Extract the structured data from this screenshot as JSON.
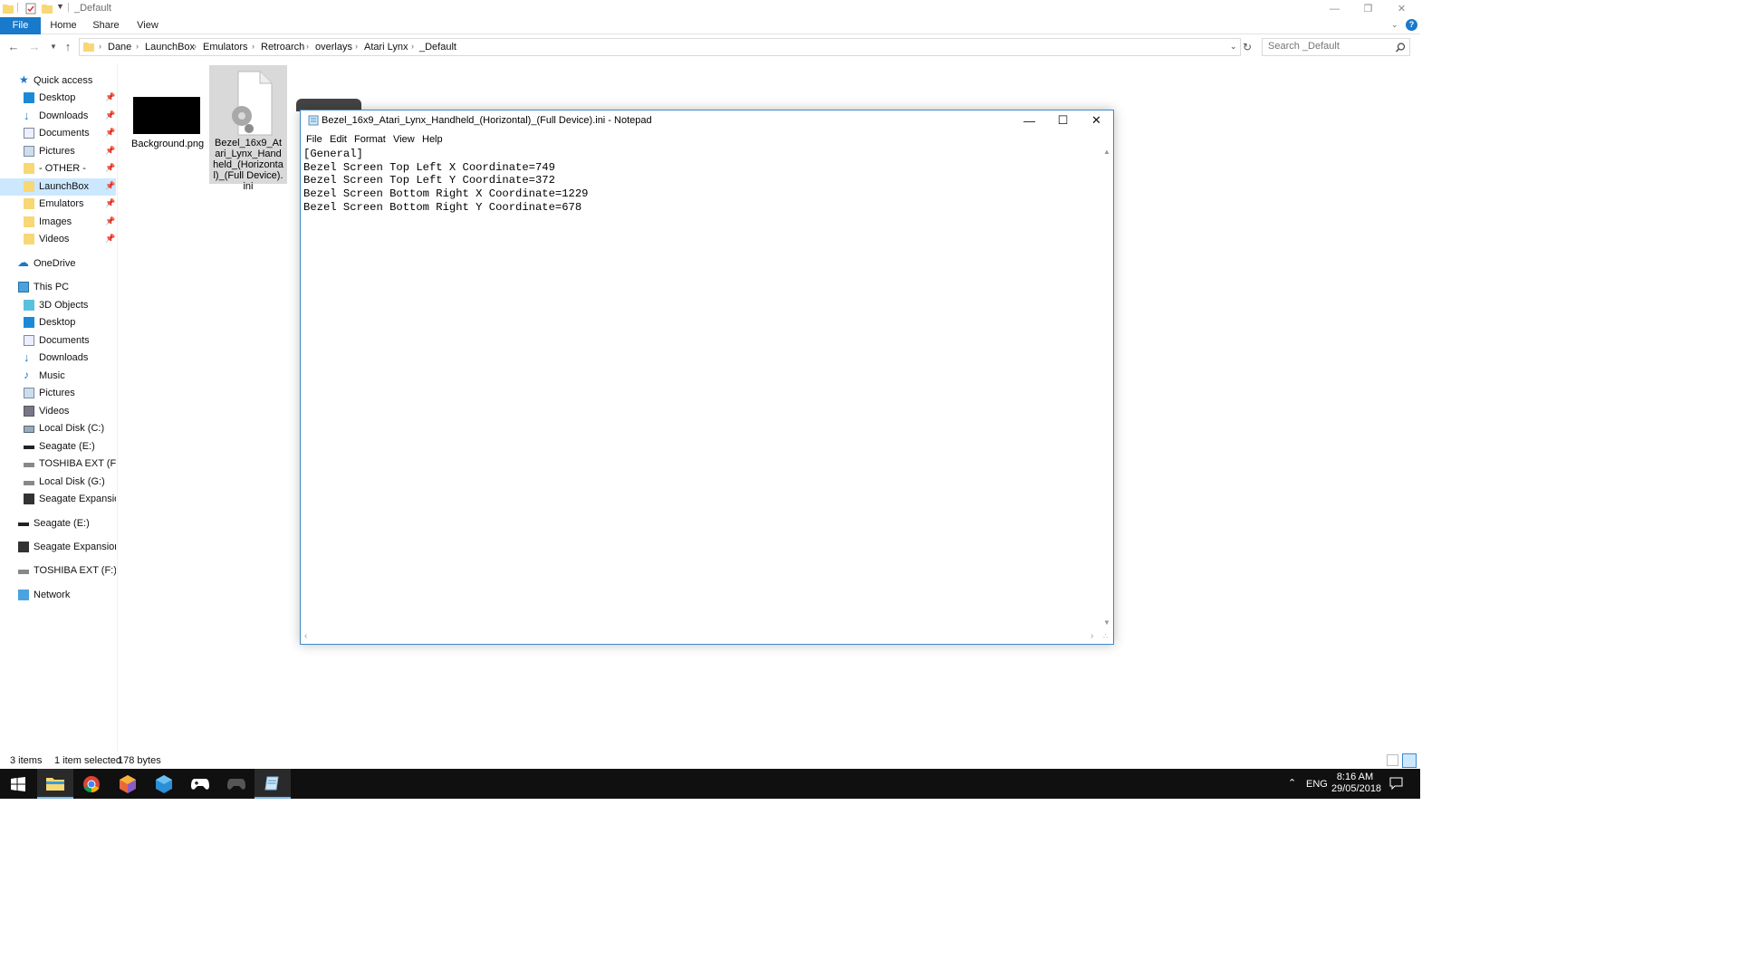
{
  "window": {
    "title": "_Default"
  },
  "ribbon": {
    "tabs": [
      "File",
      "Home",
      "Share",
      "View"
    ]
  },
  "address": {
    "crumbs": [
      "Dane",
      "LaunchBox",
      "Emulators",
      "Retroarch",
      "overlays",
      "Atari Lynx",
      "_Default"
    ],
    "search_placeholder": "Search _Default"
  },
  "nav": {
    "quick_access": "Quick access",
    "quick_items": [
      "Desktop",
      "Downloads",
      "Documents",
      "Pictures",
      "- OTHER -",
      "LaunchBox",
      "Emulators",
      "Images",
      "Videos"
    ],
    "onedrive": "OneDrive",
    "this_pc": "This PC",
    "pc_items": [
      "3D Objects",
      "Desktop",
      "Documents",
      "Downloads",
      "Music",
      "Pictures",
      "Videos",
      "Local Disk (C:)",
      "Seagate (E:)",
      "TOSHIBA EXT (F:)",
      "Local Disk (G:)",
      "Seagate Expansion D"
    ],
    "drives": [
      "Seagate (E:)",
      "Seagate Expansion Dr",
      "TOSHIBA EXT (F:)"
    ],
    "network": "Network"
  },
  "files": [
    {
      "name": "Background.png"
    },
    {
      "name": "Bezel_16x9_Atari_Lynx_Handheld_(Horizontal)_(Full Device).ini"
    }
  ],
  "notepad": {
    "title": "Bezel_16x9_Atari_Lynx_Handheld_(Horizontal)_(Full Device).ini - Notepad",
    "menu": [
      "File",
      "Edit",
      "Format",
      "View",
      "Help"
    ],
    "content": "[General]\nBezel Screen Top Left X Coordinate=749\nBezel Screen Top Left Y Coordinate=372\nBezel Screen Bottom Right X Coordinate=1229\nBezel Screen Bottom Right Y Coordinate=678"
  },
  "status": {
    "count": "3 items",
    "selected": "1 item selected",
    "size": "178 bytes"
  },
  "taskbar": {
    "language": "ENG",
    "time": "8:16 AM",
    "date": "29/05/2018",
    "apps": [
      "start-icon",
      "file-explorer-icon",
      "chrome-icon",
      "launchbox-icon",
      "box-icon",
      "gamepad-icon",
      "gamepad-dark-icon",
      "notepad-icon"
    ]
  },
  "colors": {
    "accent": "#1979ca",
    "selection": "#cce8ff",
    "notepad_border": "#3f88c9",
    "taskbar": "#101010"
  }
}
